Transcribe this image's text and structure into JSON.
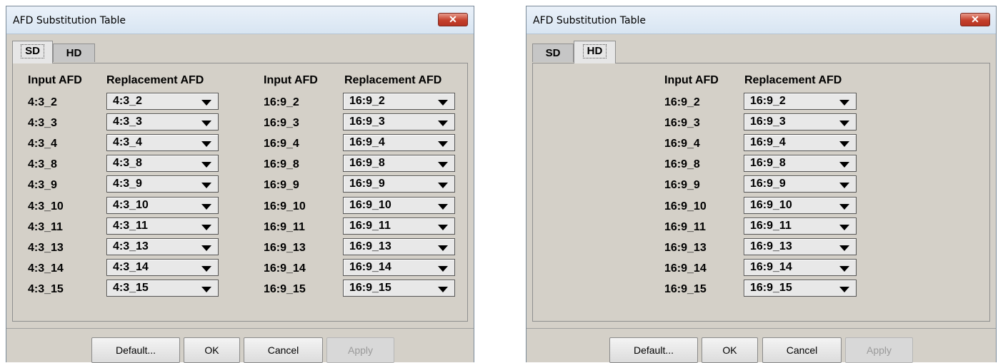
{
  "dialogs": [
    {
      "title": "AFD Substitution Table",
      "close_glyph": "✕",
      "tabs": [
        "SD",
        "HD"
      ],
      "active_tab": "SD",
      "headers": {
        "input": "Input AFD",
        "replacement": "Replacement AFD"
      },
      "columns": [
        {
          "rows": [
            {
              "input": "4:3_2",
              "replacement": "4:3_2"
            },
            {
              "input": "4:3_3",
              "replacement": "4:3_3"
            },
            {
              "input": "4:3_4",
              "replacement": "4:3_4"
            },
            {
              "input": "4:3_8",
              "replacement": "4:3_8"
            },
            {
              "input": "4:3_9",
              "replacement": "4:3_9"
            },
            {
              "input": "4:3_10",
              "replacement": "4:3_10"
            },
            {
              "input": "4:3_11",
              "replacement": "4:3_11"
            },
            {
              "input": "4:3_13",
              "replacement": "4:3_13"
            },
            {
              "input": "4:3_14",
              "replacement": "4:3_14"
            },
            {
              "input": "4:3_15",
              "replacement": "4:3_15"
            }
          ]
        },
        {
          "rows": [
            {
              "input": "16:9_2",
              "replacement": "16:9_2"
            },
            {
              "input": "16:9_3",
              "replacement": "16:9_3"
            },
            {
              "input": "16:9_4",
              "replacement": "16:9_4"
            },
            {
              "input": "16:9_8",
              "replacement": "16:9_8"
            },
            {
              "input": "16:9_9",
              "replacement": "16:9_9"
            },
            {
              "input": "16:9_10",
              "replacement": "16:9_10"
            },
            {
              "input": "16:9_11",
              "replacement": "16:9_11"
            },
            {
              "input": "16:9_13",
              "replacement": "16:9_13"
            },
            {
              "input": "16:9_14",
              "replacement": "16:9_14"
            },
            {
              "input": "16:9_15",
              "replacement": "16:9_15"
            }
          ]
        }
      ],
      "buttons": {
        "default": "Default...",
        "ok": "OK",
        "cancel": "Cancel",
        "apply": "Apply"
      }
    },
    {
      "title": "AFD Substitution Table",
      "close_glyph": "✕",
      "tabs": [
        "SD",
        "HD"
      ],
      "active_tab": "HD",
      "headers": {
        "input": "Input AFD",
        "replacement": "Replacement AFD"
      },
      "columns": [
        {
          "rows": [
            {
              "input": "16:9_2",
              "replacement": "16:9_2"
            },
            {
              "input": "16:9_3",
              "replacement": "16:9_3"
            },
            {
              "input": "16:9_4",
              "replacement": "16:9_4"
            },
            {
              "input": "16:9_8",
              "replacement": "16:9_8"
            },
            {
              "input": "16:9_9",
              "replacement": "16:9_9"
            },
            {
              "input": "16:9_10",
              "replacement": "16:9_10"
            },
            {
              "input": "16:9_11",
              "replacement": "16:9_11"
            },
            {
              "input": "16:9_13",
              "replacement": "16:9_13"
            },
            {
              "input": "16:9_14",
              "replacement": "16:9_14"
            },
            {
              "input": "16:9_15",
              "replacement": "16:9_15"
            }
          ]
        }
      ],
      "buttons": {
        "default": "Default...",
        "ok": "OK",
        "cancel": "Cancel",
        "apply": "Apply"
      }
    }
  ],
  "colors": {
    "dialog_bg": "#d4d0c8",
    "close_button": "#c4402c",
    "disabled_text": "#9a9a9a"
  },
  "icons": {
    "close": "close-icon",
    "dropdown": "chevron-down-icon"
  }
}
